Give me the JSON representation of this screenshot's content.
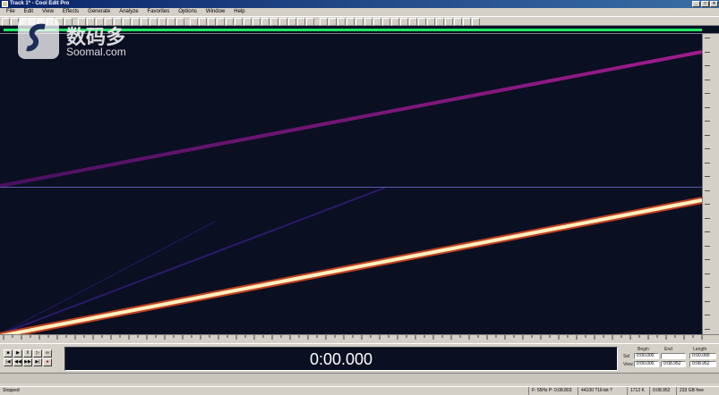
{
  "window": {
    "title": "Track 1* - Cool Edit Pro"
  },
  "menu": [
    "File",
    "Edit",
    "View",
    "Effects",
    "Generate",
    "Analyze",
    "Favorites",
    "Options",
    "Window",
    "Help"
  ],
  "toolbar": {
    "button_count": 52
  },
  "transport": {
    "buttons": [
      "stop-icon",
      "play-icon",
      "pause-icon",
      "play-from-cursor-icon",
      "loop-icon",
      "go-to-start-icon",
      "rewind-icon",
      "fast-forward-icon",
      "go-to-end-icon",
      "record-icon"
    ]
  },
  "time_display": {
    "value": "0:00.000"
  },
  "selection_view": {
    "headers": [
      "Begin",
      "End",
      "Length"
    ],
    "rows": [
      {
        "label": "Sel",
        "begin": "0:00.000",
        "end": "",
        "length": "0:00.000"
      },
      {
        "label": "View",
        "begin": "0:00.000",
        "end": "0:08.952",
        "length": "0:08.952"
      }
    ]
  },
  "status": {
    "state": "Stopped",
    "cells": [
      "F: 55Hz P: 0:08.803",
      "44100 ?16-bit ?Stereo",
      "1712 K",
      "0:08.952",
      "233 GB free"
    ]
  },
  "watermark": {
    "cn": "数码多",
    "en": "Soomal.com"
  },
  "colors": {
    "upper_sweep": "#8a1a8a",
    "lower_sweep": "#fff0c0",
    "background": "#0b0f22",
    "overview": "#20e860"
  }
}
